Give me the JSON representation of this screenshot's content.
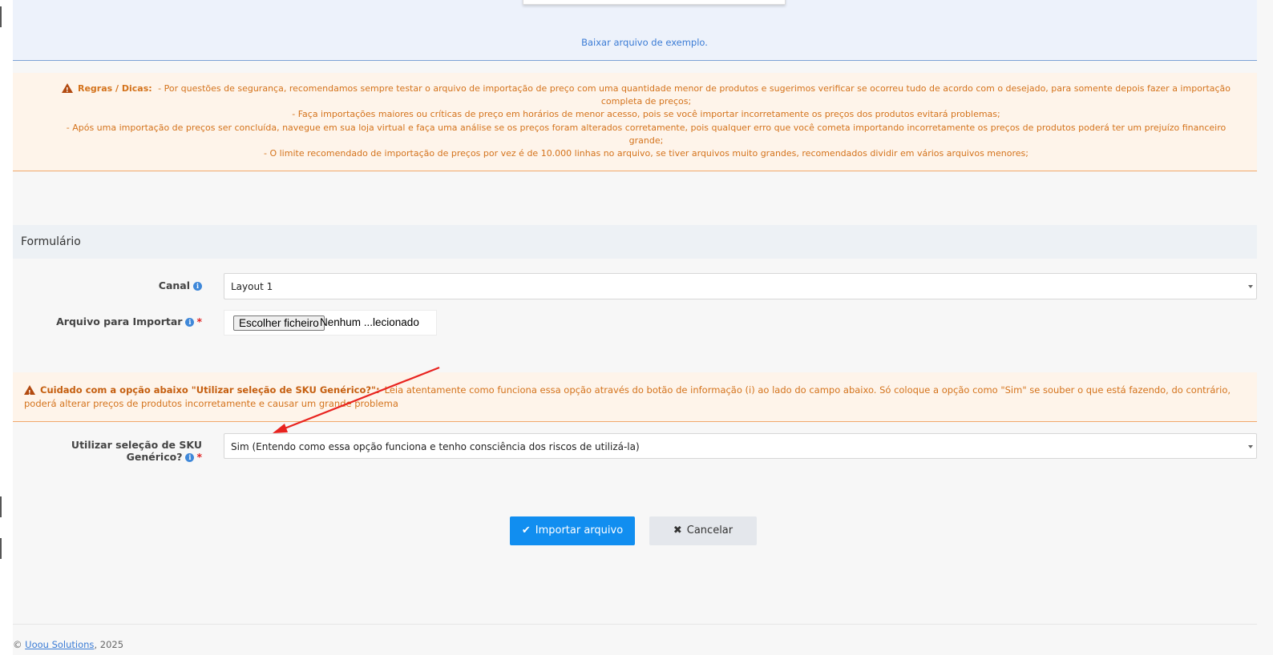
{
  "upload": {
    "example_link": "Baixar arquivo de exemplo."
  },
  "rules": {
    "title": "Regras / Dicas:",
    "line1": "- Por questões de segurança, recomendamos sempre testar o arquivo de importação de preço com uma quantidade menor de produtos e sugerimos verificar se ocorreu tudo de acordo com o desejado, para somente depois fazer a importação completa de preços;",
    "line2": "- Faça importações maiores ou críticas de preço em horários de menor acesso, pois se você importar incorretamente os preços dos produtos evitará problemas;",
    "line3": "- Após uma importação de preços ser concluída, navegue em sua loja virtual e faça uma análise se os preços foram alterados corretamente, pois qualquer erro que você cometa importando incorretamente os preços de produtos poderá ter um prejuízo financeiro grande;",
    "line4": "- O limite recomendado de importação de preços por vez é de 10.000 linhas no arquivo, se tiver arquivos muito grandes, recomendados dividir em vários arquivos menores;"
  },
  "form": {
    "header": "Formulário",
    "canal": {
      "label": "Canal",
      "value": "Layout 1"
    },
    "arquivo": {
      "label": "Arquivo para Importar",
      "button": "Escolher ficheiro",
      "filename": "Nenhum ...lecionado"
    },
    "required_mark": "*",
    "info_glyph": "i",
    "caution": {
      "title": "Cuidado com a opção abaixo \"Utilizar seleção de SKU Genérico?\":",
      "text": "Leia atentamente como funciona essa opção através do botão de informação (i) ao lado do campo abaixo. Só coloque a opção como \"Sim\" se souber o que está fazendo, do contrário, poderá alterar preços de produtos incorretamente e causar um grande problema"
    },
    "sku": {
      "label": "Utilizar seleção de SKU Genérico?",
      "value": "Sim (Entendo como essa opção funciona e tenho consciência dos riscos de utilizá-la)"
    }
  },
  "actions": {
    "import_icon": "✔",
    "import_label": "Importar arquivo",
    "cancel_icon": "✖",
    "cancel_label": "Cancelar"
  },
  "footer": {
    "copyright": "©",
    "company": "Uoou Solutions",
    "year": "2025"
  },
  "colors": {
    "primary": "#118ef0",
    "warning_text": "#d4731c",
    "warning_bg": "#fef4ea",
    "annotation_arrow": "#e8231f"
  }
}
